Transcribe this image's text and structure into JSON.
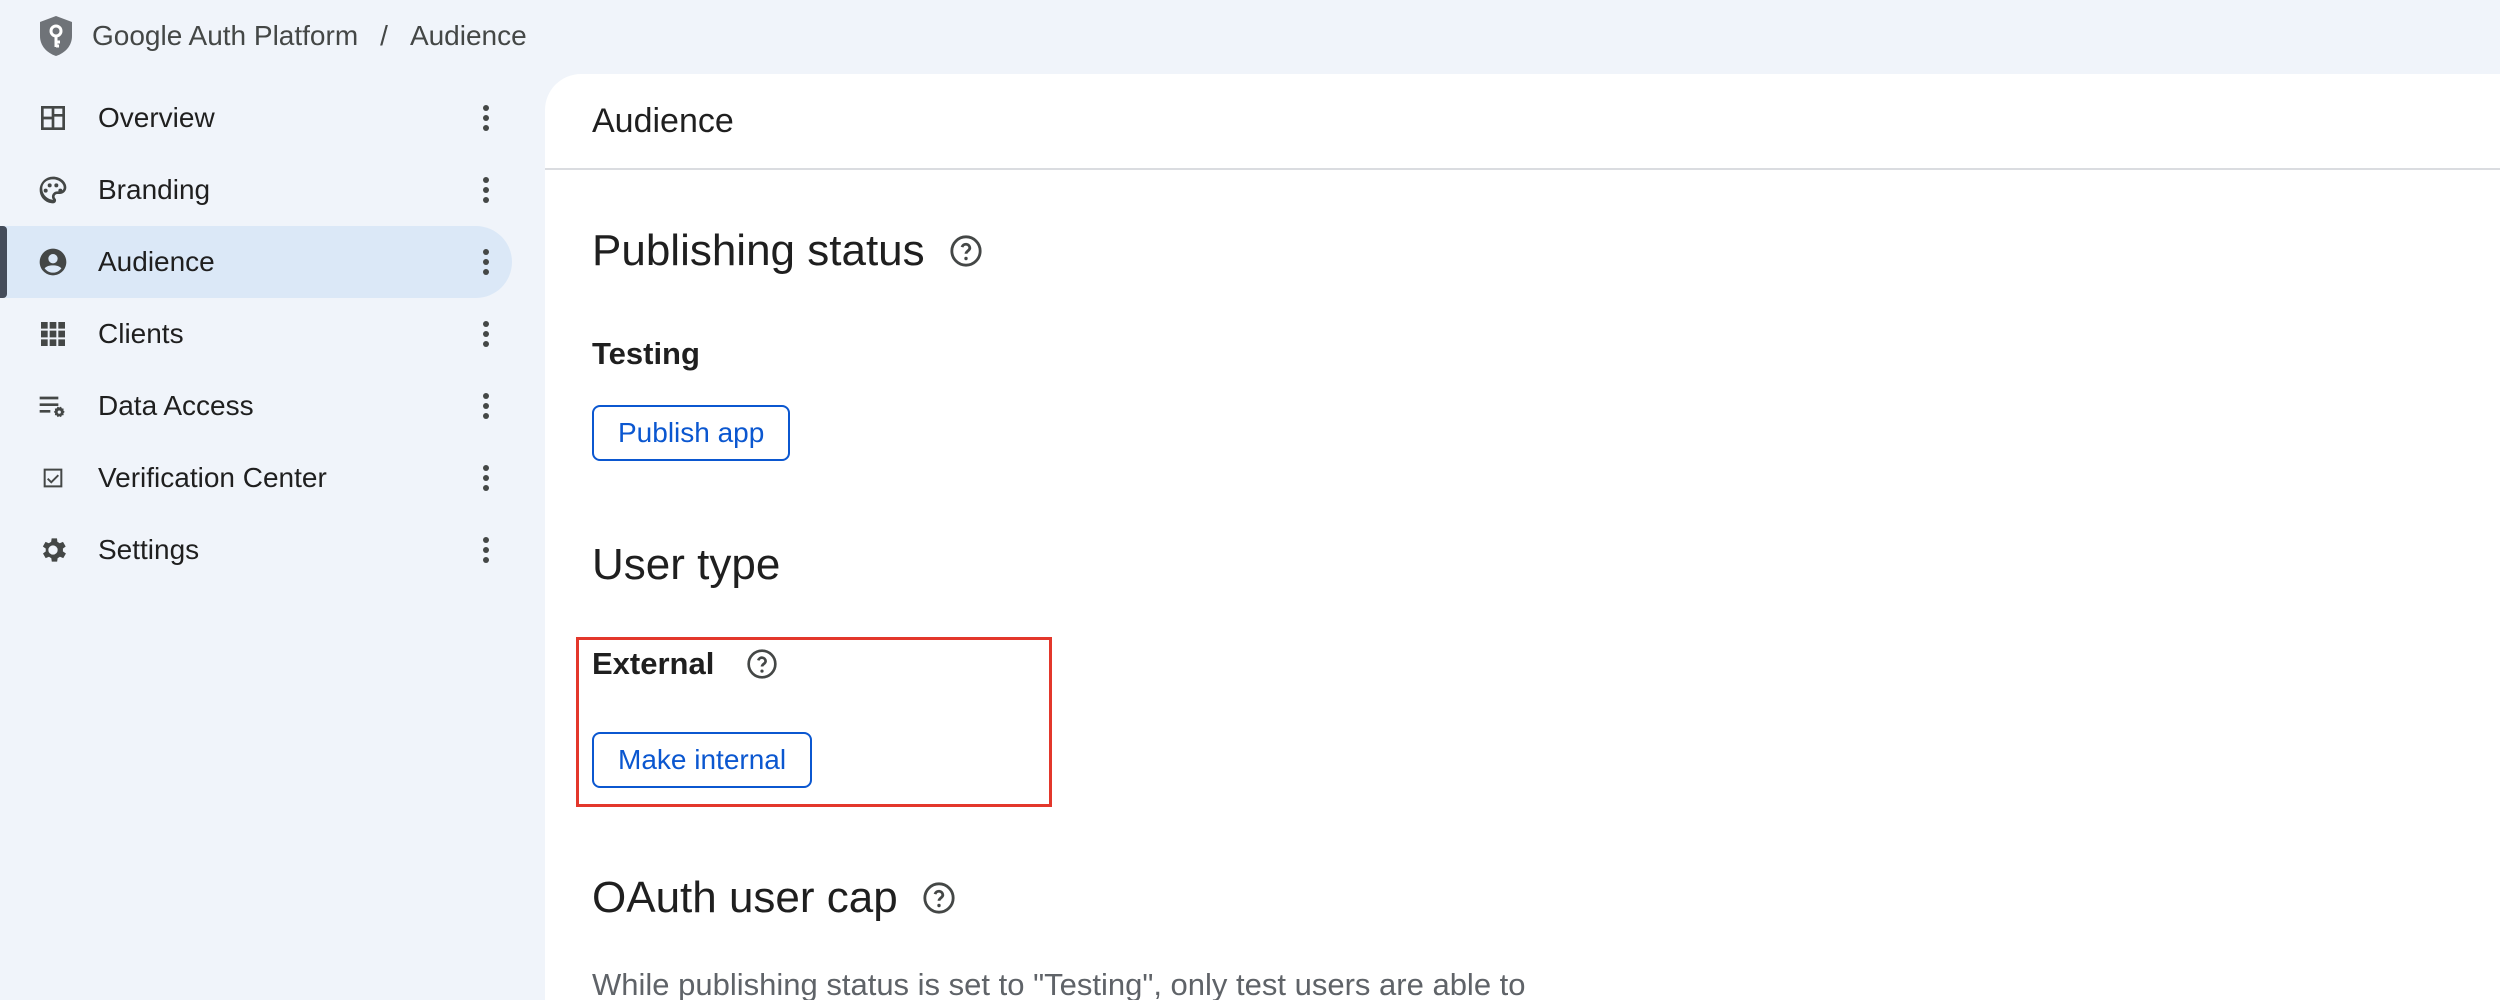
{
  "breadcrumb": {
    "product": "Google Auth Platform",
    "separator": "/",
    "current": "Audience"
  },
  "sidebar": {
    "items": [
      {
        "label": "Overview",
        "icon": "dashboard-icon",
        "active": false
      },
      {
        "label": "Branding",
        "icon": "palette-icon",
        "active": false
      },
      {
        "label": "Audience",
        "icon": "account-circle-icon",
        "active": true
      },
      {
        "label": "Clients",
        "icon": "apps-grid-icon",
        "active": false
      },
      {
        "label": "Data Access",
        "icon": "list-settings-icon",
        "active": false
      },
      {
        "label": "Verification Center",
        "icon": "checkbox-icon",
        "active": false
      },
      {
        "label": "Settings",
        "icon": "gear-icon",
        "active": false
      }
    ]
  },
  "main": {
    "header_title": "Audience",
    "publishing": {
      "title": "Publishing status",
      "status": "Testing",
      "button": "Publish app"
    },
    "user_type": {
      "title": "User type",
      "value": "External",
      "button": "Make internal"
    },
    "user_cap": {
      "title": "OAuth user cap",
      "description": "While publishing status is set to \"Testing\", only test users are able to"
    }
  },
  "colors": {
    "accent": "#0b57d0",
    "active_nav_bg": "#dbe8f7",
    "highlight": "#e3372b",
    "page_bg": "#f0f4fa"
  }
}
